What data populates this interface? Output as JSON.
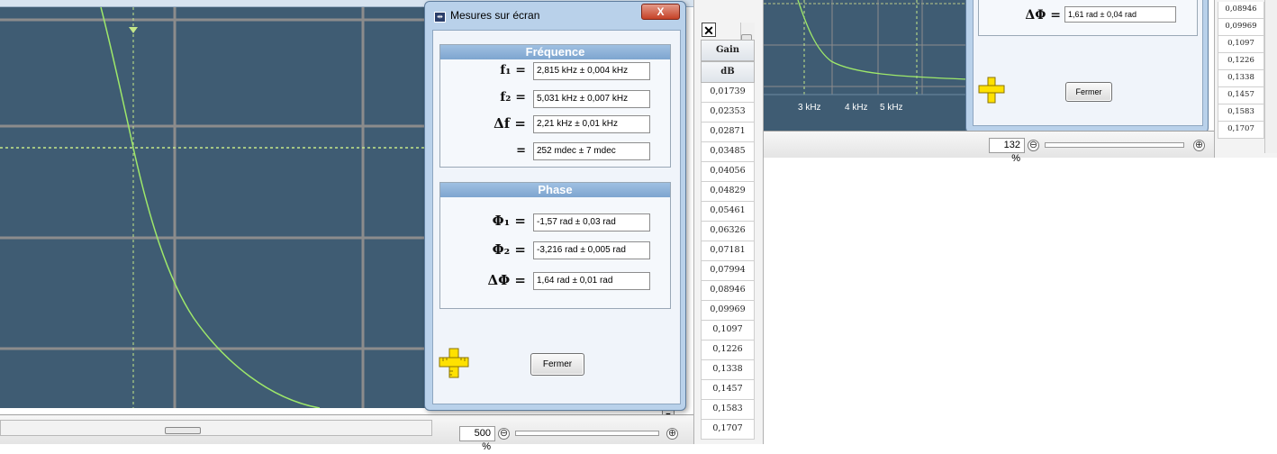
{
  "left_window": {
    "zoom": "500 %",
    "zoom_out": "⊖",
    "zoom_in": "⊕",
    "scroll_down": "▼"
  },
  "dialog": {
    "title": "Mesures sur écran",
    "close": "X",
    "frequence": {
      "title": "Fréquence",
      "rows": [
        {
          "label": "f₁ =",
          "value": "2,815 kHz ± 0,004 kHz"
        },
        {
          "label": "f₂ =",
          "value": "5,031 kHz ± 0,007 kHz"
        },
        {
          "label": "Δf =",
          "value": "2,21 kHz ± 0,01 kHz"
        },
        {
          "label": "=",
          "value": "252 mdec ± 7 mdec"
        }
      ]
    },
    "phase": {
      "title": "Phase",
      "rows": [
        {
          "label": "Φ₁ =",
          "value": "-1,57 rad ± 0,03 rad"
        },
        {
          "label": "Φ₂ =",
          "value": "-3,216 rad ± 0,005 rad"
        },
        {
          "label": "ΔΦ =",
          "value": "1,64 rad ± 0,01 rad"
        }
      ]
    },
    "close_button": "Fermer"
  },
  "table": {
    "header_icon": "✕",
    "col_header": "Gain",
    "unit_header": "dB",
    "values": [
      "0,01739",
      "0,02353",
      "0,02871",
      "0,03485",
      "0,04056",
      "0,04829",
      "0,05461",
      "0,06326",
      "0,07181",
      "0,07994",
      "0,08946",
      "0,09969",
      "0,1097",
      "0,1226",
      "0,1338",
      "0,1457",
      "0,1583",
      "0,1707"
    ]
  },
  "right_window": {
    "axis_ticks": [
      "3 kHz",
      "4 kHz",
      "5 kHz"
    ],
    "zoom": "132 %",
    "zoom_out": "⊖",
    "zoom_in": "⊕",
    "dialog_row": {
      "label": "ΔΦ =",
      "value": "1,61 rad ± 0,04 rad"
    },
    "close_button": "Fermer",
    "table_values": [
      "0,08946",
      "0,09969",
      "0,1097",
      "0,1226",
      "0,1338",
      "0,1457",
      "0,1583",
      "0,1707"
    ]
  },
  "colors": {
    "plot_bg": "#3f5c73",
    "curve": "#9ee86a",
    "grid": "#8c8c8c",
    "dialog_header": "#8fb3da"
  },
  "icons": [
    "ruler-cross-icon",
    "dialog-app-icon",
    "close-icon"
  ]
}
